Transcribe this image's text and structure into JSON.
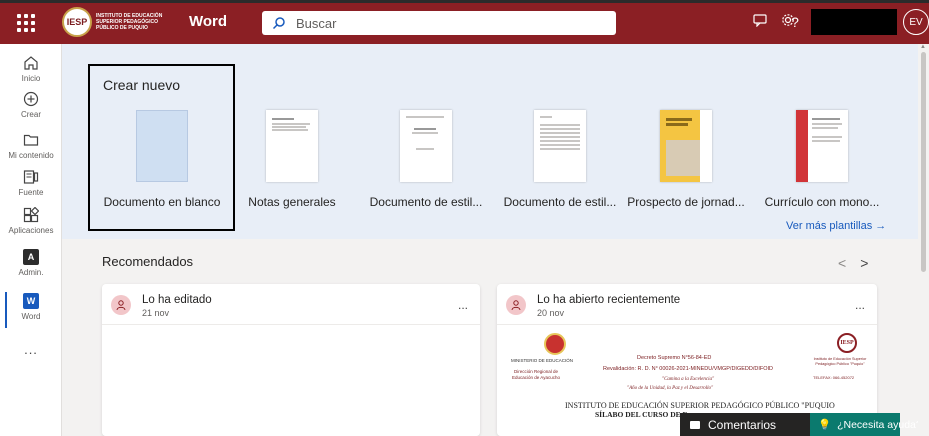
{
  "header": {
    "logo_text": "Instituto de Educación Superior Pedagógico Público de Puquio",
    "logo_seal": "IESP",
    "app_name": "Word",
    "search_placeholder": "Buscar",
    "user_initials": "EV",
    "icons": [
      "waffle-icon",
      "search-icon",
      "feedback-icon",
      "settings-icon",
      "help-icon"
    ],
    "help_glyph": "?"
  },
  "rail": {
    "items": [
      {
        "label": "Inicio",
        "icon": "home-icon"
      },
      {
        "label": "Crear",
        "icon": "plus-circle-icon"
      },
      {
        "label": "Mi contenido",
        "icon": "folder-icon"
      },
      {
        "label": "Fuente",
        "icon": "feed-icon"
      },
      {
        "label": "Aplicaciones",
        "icon": "apps-icon"
      },
      {
        "label": "Admin.",
        "icon": "admin-icon"
      },
      {
        "label": "Word",
        "icon": "word-icon"
      }
    ],
    "more": "..."
  },
  "create": {
    "title": "Crear nuevo",
    "templates": [
      {
        "name": "Documento en blanco"
      },
      {
        "name": "Notas generales"
      },
      {
        "name": "Documento de estil..."
      },
      {
        "name": "Documento de estil..."
      },
      {
        "name": "Prospecto de jornad..."
      },
      {
        "name": "Currículo con mono..."
      }
    ],
    "more_templates": "Ver más plantillas →"
  },
  "recommended": {
    "title": "Recomendados",
    "prev": "<",
    "next": ">",
    "cards": [
      {
        "action": "Lo ha editado",
        "date": "21 nov",
        "menu": "..."
      },
      {
        "action": "Lo ha abierto recientemente",
        "date": "20 nov",
        "menu": "..."
      }
    ],
    "preview": {
      "ministry": "MINISTERIO DE EDUCACIÓN",
      "region": "Dirección Regional de Educación de Ayacucho",
      "decree": "Decreto Supremo N°56-84-ED",
      "resolution": "Revalidación: R. D. N° 00026-2021-MINEDU/VMGP/DIGEDD/DIFOID",
      "motto1": "\"Camina a la Excelencia\"",
      "motto2": "\"Año de la Unidad, la Paz y el Desarrollo\"",
      "seal": "IESP",
      "inst_small": "Instituto de Educación Superior Pedagógico Público \"Puquio\"",
      "tel": "TELEFAX: 066-452072",
      "inst_main": "INSTITUTO DE EDUCACIÓN SUPERIOR PEDAGÓGICO PÚBLICO \"PUQUIO",
      "silabo": "SÍLABO DEL CURSO DE F"
    }
  },
  "footer": {
    "comments": "Comentarios",
    "help": "¿Necesita ayuda?"
  },
  "colors": {
    "brand": "#8b1f24",
    "accent": "#185abd",
    "help_button": "#0b7a6e"
  }
}
